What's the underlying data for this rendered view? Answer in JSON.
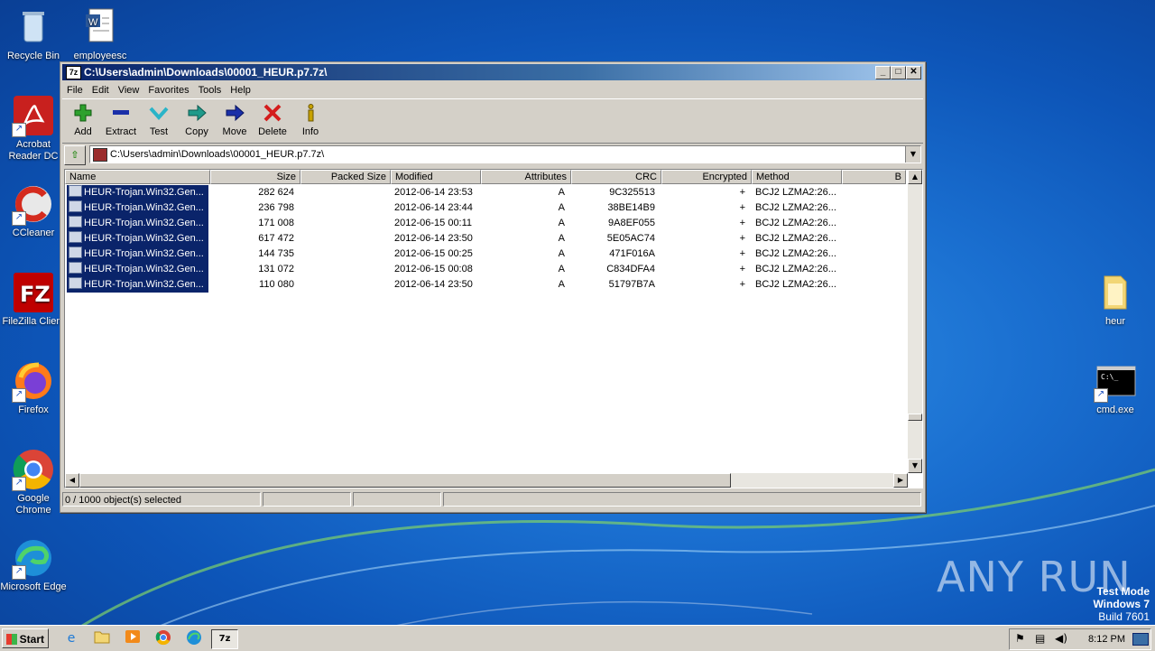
{
  "desktop": {
    "icons_left": [
      {
        "label": "Recycle Bin",
        "icon": "recycle-bin-icon"
      },
      {
        "label": "employeesc",
        "icon": "word-doc-icon"
      },
      {
        "label": "Acrobat Reader DC",
        "icon": "acrobat-icon"
      },
      {
        "label": "CCleaner",
        "icon": "ccleaner-icon"
      },
      {
        "label": "FileZilla Client",
        "icon": "filezilla-icon"
      },
      {
        "label": "Firefox",
        "icon": "firefox-icon"
      },
      {
        "label": "Google Chrome",
        "icon": "chrome-icon"
      },
      {
        "label": "Microsoft Edge",
        "icon": "edge-icon"
      }
    ],
    "icons_right": [
      {
        "label": "heur",
        "icon": "folder-icon"
      },
      {
        "label": "cmd.exe",
        "icon": "cmd-icon"
      }
    ],
    "watermark": "ANY RUN",
    "test_mode": {
      "line1": "Test Mode",
      "line2": "Windows 7",
      "line3": "Build 7601"
    }
  },
  "window": {
    "title": "C:\\Users\\admin\\Downloads\\00001_HEUR.p7.7z\\",
    "app_icon_text": "7z",
    "menu": [
      "File",
      "Edit",
      "View",
      "Favorites",
      "Tools",
      "Help"
    ],
    "toolbar": [
      {
        "label": "Add",
        "icon": "add-icon",
        "color": "#2ea12e"
      },
      {
        "label": "Extract",
        "icon": "extract-icon",
        "color": "#1a2fa8"
      },
      {
        "label": "Test",
        "icon": "test-icon",
        "color": "#2ab4c8"
      },
      {
        "label": "Copy",
        "icon": "copy-icon",
        "color": "#1f9a8a"
      },
      {
        "label": "Move",
        "icon": "move-icon",
        "color": "#1a2fa8"
      },
      {
        "label": "Delete",
        "icon": "delete-icon",
        "color": "#d41c1c"
      },
      {
        "label": "Info",
        "icon": "info-icon",
        "color": "#c8a200"
      }
    ],
    "address": "C:\\Users\\admin\\Downloads\\00001_HEUR.p7.7z\\",
    "columns": [
      "Name",
      "Size",
      "Packed Size",
      "Modified",
      "Attributes",
      "CRC",
      "Encrypted",
      "Method",
      "B"
    ],
    "rows": [
      {
        "name": "HEUR-Trojan.Win32.Gen...",
        "size": "282 624",
        "packed": "",
        "modified": "2012-06-14 23:53",
        "attr": "A",
        "crc": "9C325513",
        "enc": "+",
        "method": "BCJ2 LZMA2:26..."
      },
      {
        "name": "HEUR-Trojan.Win32.Gen...",
        "size": "236 798",
        "packed": "",
        "modified": "2012-06-14 23:44",
        "attr": "A",
        "crc": "38BE14B9",
        "enc": "+",
        "method": "BCJ2 LZMA2:26..."
      },
      {
        "name": "HEUR-Trojan.Win32.Gen...",
        "size": "171 008",
        "packed": "",
        "modified": "2012-06-15 00:11",
        "attr": "A",
        "crc": "9A8EF055",
        "enc": "+",
        "method": "BCJ2 LZMA2:26..."
      },
      {
        "name": "HEUR-Trojan.Win32.Gen...",
        "size": "617 472",
        "packed": "",
        "modified": "2012-06-14 23:50",
        "attr": "A",
        "crc": "5E05AC74",
        "enc": "+",
        "method": "BCJ2 LZMA2:26..."
      },
      {
        "name": "HEUR-Trojan.Win32.Gen...",
        "size": "144 735",
        "packed": "",
        "modified": "2012-06-15 00:25",
        "attr": "A",
        "crc": "471F016A",
        "enc": "+",
        "method": "BCJ2 LZMA2:26..."
      },
      {
        "name": "HEUR-Trojan.Win32.Gen...",
        "size": "131 072",
        "packed": "",
        "modified": "2012-06-15 00:08",
        "attr": "A",
        "crc": "C834DFA4",
        "enc": "+",
        "method": "BCJ2 LZMA2:26..."
      },
      {
        "name": "HEUR-Trojan.Win32.Gen...",
        "size": "110 080",
        "packed": "",
        "modified": "2012-06-14 23:50",
        "attr": "A",
        "crc": "51797B7A",
        "enc": "+",
        "method": "BCJ2 LZMA2:26..."
      }
    ],
    "status": "0 / 1000 object(s) selected"
  },
  "taskbar": {
    "start_label": "Start",
    "clock": "8:12 PM",
    "pinned": [
      "ie-icon",
      "explorer-icon",
      "media-player-icon",
      "chrome-icon",
      "edge-icon",
      "7zip-icon"
    ]
  }
}
